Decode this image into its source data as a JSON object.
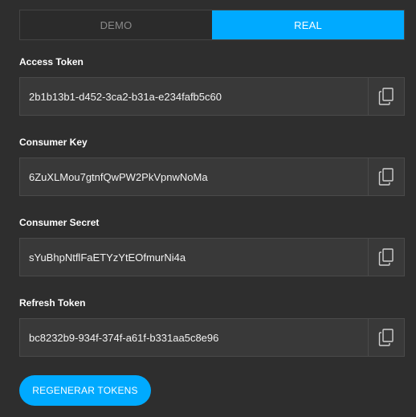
{
  "tabs": [
    {
      "label": "DEMO",
      "active": false
    },
    {
      "label": "REAL",
      "active": true
    }
  ],
  "fields": [
    {
      "label": "Access Token",
      "value": "2b1b13b1-d452-3ca2-b31a-e234fafb5c60",
      "icon": "copy-icon"
    },
    {
      "label": "Consumer Key",
      "value": "6ZuXLMou7gtnfQwPW2PkVpnwNoMa",
      "icon": "copy-icon"
    },
    {
      "label": "Consumer Secret",
      "value": "sYuBhpNtflFaETYzYtEOfmurNi4a",
      "icon": "copy-icon"
    },
    {
      "label": "Refresh Token",
      "value": "bc8232b9-934f-374f-a61f-b331aa5c8e96",
      "icon": "copy-icon"
    }
  ],
  "actions": {
    "regenerate_label": "REGENERAR TOKENS"
  },
  "colors": {
    "accent": "#00aaff",
    "background": "#2e2e2e",
    "field_background": "#393939"
  }
}
